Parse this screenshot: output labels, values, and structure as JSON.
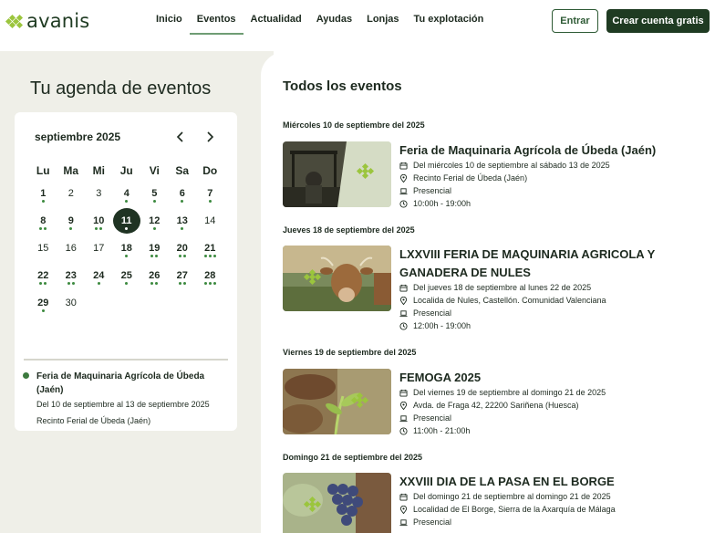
{
  "brand": {
    "name": "avanis"
  },
  "nav": {
    "items": [
      {
        "label": "Inicio",
        "active": false
      },
      {
        "label": "Eventos",
        "active": true
      },
      {
        "label": "Actualidad",
        "active": false
      },
      {
        "label": "Ayudas",
        "active": false
      },
      {
        "label": "Lonjas",
        "active": false
      },
      {
        "label": "Tu explotación",
        "active": false
      }
    ],
    "login_label": "Entrar",
    "signup_label": "Crear cuenta gratis"
  },
  "agenda": {
    "title": "Tu agenda de eventos",
    "month_label": "septiembre 2025",
    "prev_icon": "chevron-left-icon",
    "next_icon": "chevron-right-icon",
    "weekdays": [
      "Lu",
      "Ma",
      "Mi",
      "Ju",
      "Vi",
      "Sa",
      "Do"
    ],
    "days": [
      {
        "n": "1",
        "dots": 1
      },
      {
        "n": "2",
        "dots": 0
      },
      {
        "n": "3",
        "dots": 0
      },
      {
        "n": "4",
        "dots": 1
      },
      {
        "n": "5",
        "dots": 1
      },
      {
        "n": "6",
        "dots": 1
      },
      {
        "n": "7",
        "dots": 1
      },
      {
        "n": "8",
        "dots": 2
      },
      {
        "n": "9",
        "dots": 1
      },
      {
        "n": "10",
        "dots": 2
      },
      {
        "n": "11",
        "dots": 1,
        "today": true
      },
      {
        "n": "12",
        "dots": 1
      },
      {
        "n": "13",
        "dots": 1
      },
      {
        "n": "14",
        "dots": 0
      },
      {
        "n": "15",
        "dots": 0
      },
      {
        "n": "16",
        "dots": 0
      },
      {
        "n": "17",
        "dots": 0
      },
      {
        "n": "18",
        "dots": 1
      },
      {
        "n": "19",
        "dots": 2
      },
      {
        "n": "20",
        "dots": 2
      },
      {
        "n": "21",
        "dots": 3
      },
      {
        "n": "22",
        "dots": 2
      },
      {
        "n": "23",
        "dots": 2
      },
      {
        "n": "24",
        "dots": 1
      },
      {
        "n": "25",
        "dots": 1
      },
      {
        "n": "26",
        "dots": 2
      },
      {
        "n": "27",
        "dots": 2
      },
      {
        "n": "28",
        "dots": 3
      },
      {
        "n": "29",
        "dots": 1
      },
      {
        "n": "30",
        "dots": 0
      }
    ],
    "selected": {
      "title": "Feria de Maquinaria Agrícola de Úbeda (Jaén)",
      "dates": "Del 10 de septiembre al 13 de septiembre 2025",
      "place": "Recinto Ferial de Úbeda (Jaén)"
    }
  },
  "events": {
    "heading": "Todos los eventos",
    "groups": [
      {
        "date": "Miércoles 10 de septiembre del 2025",
        "title": "Feria de Maquinaria Agrícola de Úbeda (Jaén)",
        "dates": "Del miércoles 10 de septiembre al sábado 13 de 2025",
        "place": "Recinto Ferial de Úbeda (Jaén)",
        "mode": "Presencial",
        "time": "10:00h - 19:00h",
        "image": "tractor-photo"
      },
      {
        "date": "Jueves 18 de septiembre del 2025",
        "title": "LXXVIII FERIA DE MAQUINARIA AGRICOLA Y GANADERA DE NULES",
        "dates": "Del jueves 18 de septiembre al lunes 22 de 2025",
        "place": "Localida de Nules, Castellón. Comunidad Valenciana",
        "mode": "Presencial",
        "time": "12:00h - 19:00h",
        "image": "cow-photo"
      },
      {
        "date": "Viernes 19 de septiembre del 2025",
        "title": "FEMOGA 2025",
        "dates": "Del viernes 19 de septiembre al domingo 21 de 2025",
        "place": "Avda. de Fraga 42, 22200 Sariñena (Huesca)",
        "mode": "Presencial",
        "time": "11:00h - 21:00h",
        "image": "seedling-photo"
      },
      {
        "date": "Domingo 21 de septiembre del 2025",
        "title": "XXVIII DIA DE LA PASA EN EL BORGE",
        "dates": "Del domingo 21 de septiembre al domingo 21 de 2025",
        "place": "Localidad de El Borge, Sierra de la Axarquía de Málaga",
        "mode": "Presencial",
        "time": "",
        "image": "grapes-photo"
      }
    ]
  },
  "colors": {
    "brand_dark": "#1f3b22",
    "accent": "#9bc53d",
    "dot": "#3c8a3f",
    "panel": "#efefe8"
  }
}
